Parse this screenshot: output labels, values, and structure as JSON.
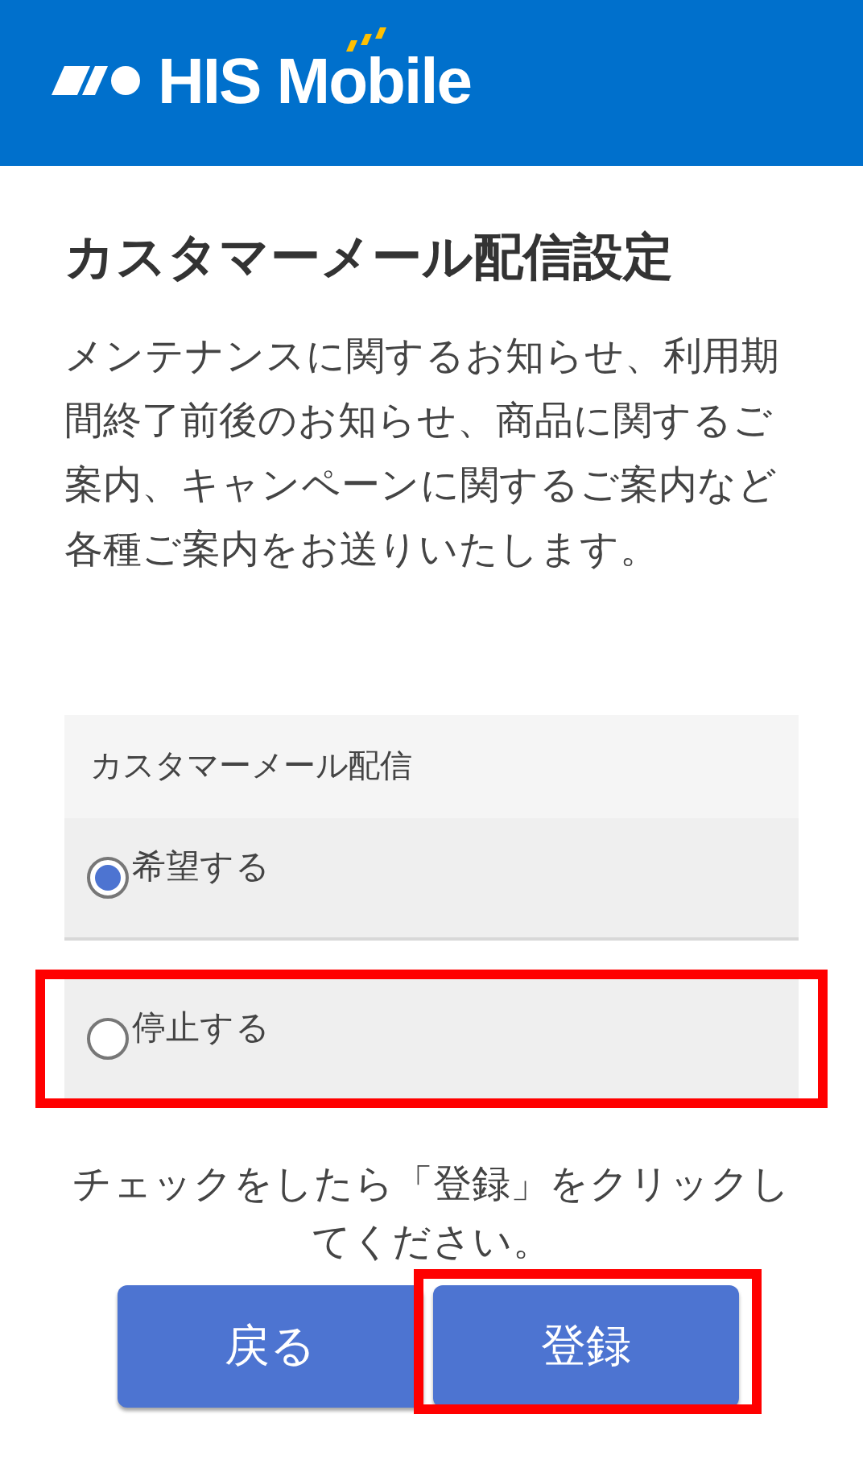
{
  "header": {
    "logo_text": "HIS Mobile"
  },
  "title": "カスタマーメール配信設定",
  "description": "メンテナンスに関するお知らせ、利用期間終了前後のお知らせ、商品に関するご案内、キャンペーンに関するご案内など各種ご案内をお送りいたします。",
  "setting": {
    "label": "カスタマーメール配信",
    "options": [
      {
        "label": "希望する",
        "selected": true,
        "highlighted": false
      },
      {
        "label": "停止する",
        "selected": false,
        "highlighted": true
      }
    ]
  },
  "instruction": "チェックをしたら「登録」をクリックしてください。",
  "buttons": [
    {
      "label": "戻る",
      "highlighted": false
    },
    {
      "label": "登録",
      "highlighted": true
    }
  ]
}
